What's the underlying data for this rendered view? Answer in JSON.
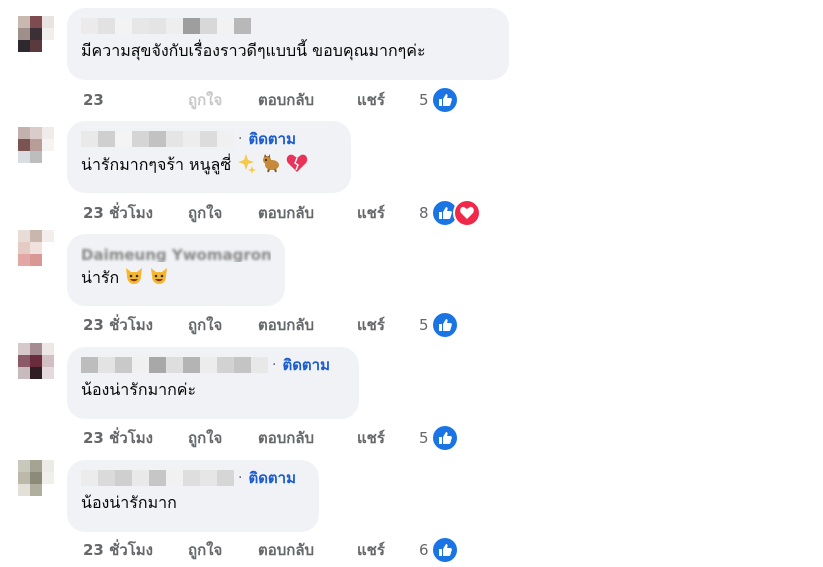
{
  "colors": {
    "accent_blue": "#1b5cd0",
    "like_blue": "#1b74e4",
    "love_red": "#f02849",
    "bubble_bg": "#f0f2f5",
    "muted": "#65676b"
  },
  "actions": {
    "like": "ถูกใจ",
    "reply": "ตอบกลับ",
    "share": "แชร์",
    "follow": "ติดตาม"
  },
  "comments": [
    {
      "text": "มีความสุขจังกับเรื่องราวดีๆแบบนี้ ขอบคุณมากๆค่ะ",
      "time": "23",
      "reactions": "5",
      "reaction_icons": [
        "like-icon"
      ]
    },
    {
      "text": "น่ารักมากๆจร้า หนูลูซี่",
      "time": "23 ชั่วโมง",
      "reactions": "8",
      "reaction_icons": [
        "like-icon",
        "love-icon"
      ],
      "emoji": [
        "sparkles-icon",
        "dog-icon",
        "heart-icon"
      ]
    },
    {
      "name_partial": "Daimeung Ywomagron",
      "text": "น่ารัก",
      "time": "23 ชั่วโมง",
      "reactions": "5",
      "reaction_icons": [
        "like-icon"
      ],
      "emoji": [
        "cat-smile-icon",
        "cat-smile-icon"
      ]
    },
    {
      "text": "น้องน่ารักมากค่ะ",
      "time": "23 ชั่วโมง",
      "reactions": "5",
      "reaction_icons": [
        "like-icon"
      ]
    },
    {
      "text": "น้องน่ารักมาก",
      "time": "23 ชั่วโมง",
      "reactions": "6",
      "reaction_icons": [
        "like-icon"
      ]
    }
  ]
}
